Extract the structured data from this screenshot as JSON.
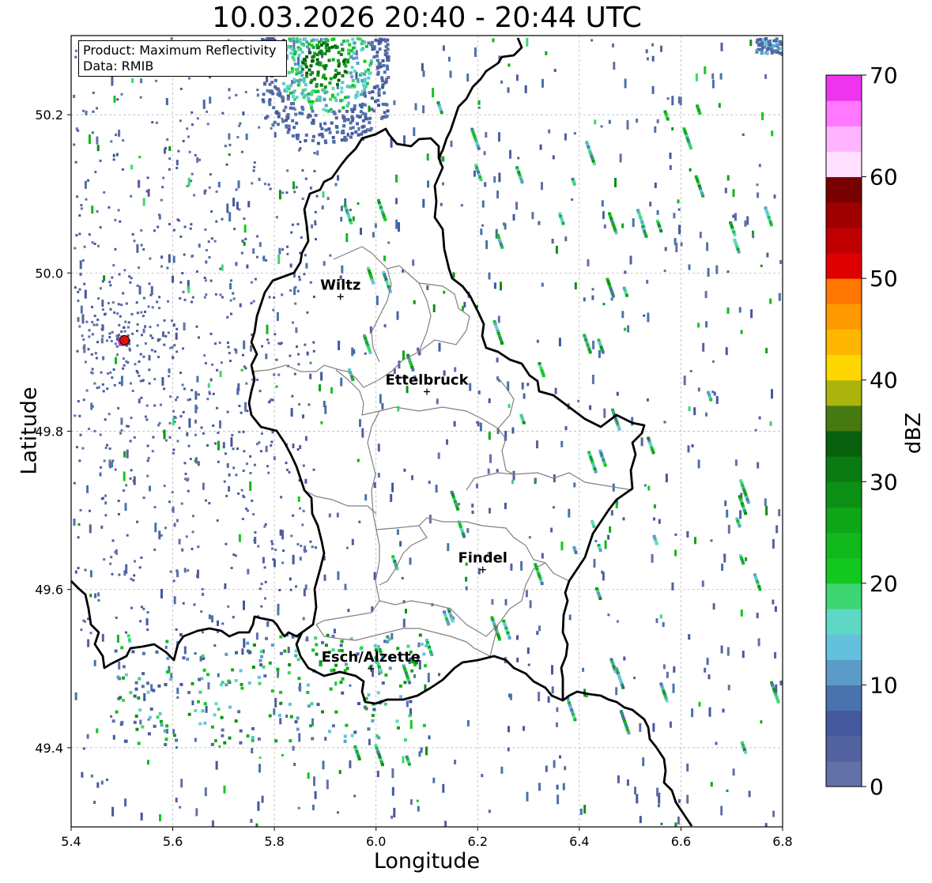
{
  "title": "10.03.2026 20:40 - 20:44 UTC",
  "info_box": {
    "product_line": "Product: Maximum Reflectivity",
    "data_line": "Data: RMIB"
  },
  "axes": {
    "xlabel": "Longitude",
    "ylabel": "Latitude",
    "xlim": [
      5.4,
      6.8
    ],
    "ylim": [
      49.3,
      50.3
    ],
    "xticks": [
      "5.4",
      "5.6",
      "5.8",
      "6.0",
      "6.2",
      "6.4",
      "6.6",
      "6.8"
    ],
    "yticks": [
      "49.4",
      "49.6",
      "49.8",
      "50.0",
      "50.2"
    ],
    "grid": true
  },
  "colorbar": {
    "label": "dBZ",
    "ticks": [
      "0",
      "10",
      "20",
      "30",
      "40",
      "50",
      "60",
      "70"
    ],
    "range": [
      0,
      70
    ],
    "colors": [
      "#6171a6",
      "#52629f",
      "#44589e",
      "#4a72ac",
      "#5a9cc7",
      "#63c1de",
      "#5ed8c4",
      "#3dd672",
      "#12c81e",
      "#10b81c",
      "#0ea518",
      "#0c8f15",
      "#0a7a12",
      "#085f0e",
      "#467a10",
      "#aab40c",
      "#ffd700",
      "#ffb600",
      "#ff9900",
      "#ff7700",
      "#e00000",
      "#c00000",
      "#a00000",
      "#780000",
      "#ffe0ff",
      "#ffb4ff",
      "#ff78ff",
      "#ee34ee"
    ]
  },
  "cities": [
    {
      "name": "Wiltz",
      "lon": 5.93,
      "lat": 49.97
    },
    {
      "name": "Ettelbruck",
      "lon": 6.1,
      "lat": 49.85
    },
    {
      "name": "Findel",
      "lon": 6.21,
      "lat": 49.625
    },
    {
      "name": "Esch/Alzette",
      "lon": 5.99,
      "lat": 49.5
    }
  ],
  "radar_site": {
    "lon": 5.505,
    "lat": 49.915,
    "color": "#e01010"
  }
}
